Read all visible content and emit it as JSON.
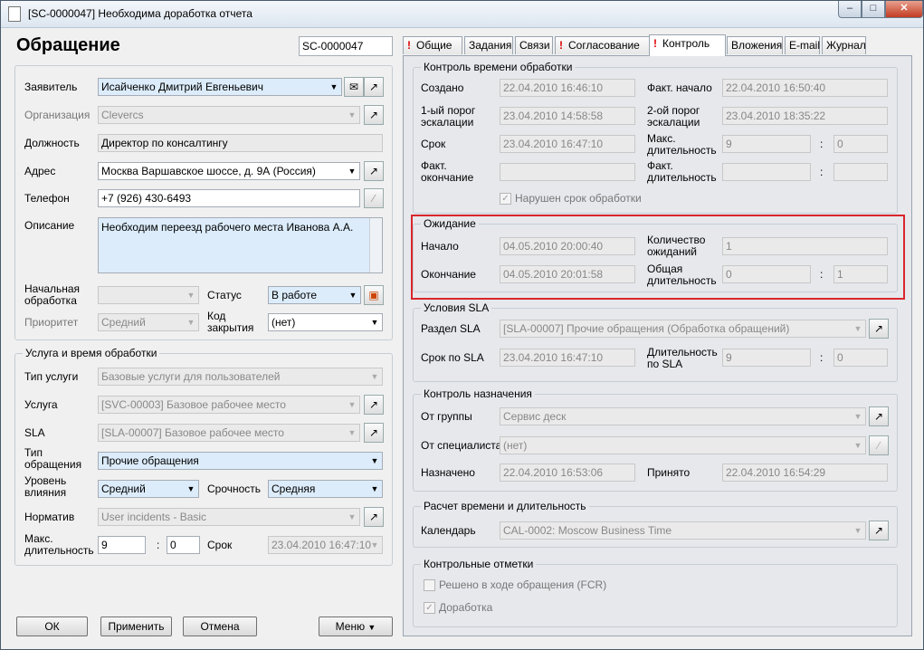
{
  "window": {
    "title": "[SC-0000047] Необходима доработка отчета"
  },
  "header": {
    "title": "Обращение",
    "number": "SC-0000047"
  },
  "left": {
    "applicant": {
      "label": "Заявитель",
      "value": "Исайченко Дмитрий Евгеньевич"
    },
    "organization": {
      "label": "Организация",
      "value": "Clevercs"
    },
    "position": {
      "label": "Должность",
      "value": "Директор по консалтингу"
    },
    "address": {
      "label": "Адрес",
      "value": "Москва Варшавское шоссе, д. 9А (Россия)"
    },
    "phone": {
      "label": "Телефон",
      "value": "+7 (926) 430-6493"
    },
    "description": {
      "label": "Описание",
      "value": "Необходим переезд рабочего места Иванова А.А."
    },
    "initial": {
      "label1": "Начальная",
      "label2": "обработка",
      "value": ""
    },
    "status": {
      "label": "Статус",
      "value": "В работе"
    },
    "priority": {
      "label": "Приоритет",
      "value": "Средний"
    },
    "close_code": {
      "label1": "Код",
      "label2": "закрытия",
      "value": "(нет)"
    }
  },
  "service": {
    "title": "Услуга и время обработки",
    "service_type": {
      "label": "Тип услуги",
      "value": "Базовые услуги для пользователей"
    },
    "service": {
      "label": "Услуга",
      "value": "[SVC-00003] Базовое рабочее место"
    },
    "sla": {
      "label": "SLA",
      "value": "[SLA-00007] Базовое рабочее место"
    },
    "request_type": {
      "label1": "Тип",
      "label2": "обращения",
      "value": "Прочие обращения"
    },
    "impact": {
      "label1": "Уровень",
      "label2": "влияния",
      "value": "Средний"
    },
    "urgency": {
      "label": "Срочность",
      "value": "Средняя"
    },
    "norm": {
      "label": "Норматив",
      "value": "User incidents - Basic"
    },
    "max_duration": {
      "label1": "Макс.",
      "label2": "длительность",
      "hours": "9",
      "minutes": "0"
    },
    "deadline": {
      "label": "Срок",
      "value": "23.04.2010 16:47:10"
    }
  },
  "buttons": {
    "ok": "ОК",
    "apply": "Применить",
    "cancel": "Отмена",
    "menu": "Меню"
  },
  "tabs": [
    {
      "label": "Общие",
      "alert": true
    },
    {
      "label": "Задания",
      "alert": false
    },
    {
      "label": "Связи",
      "alert": false
    },
    {
      "label": "Согласование",
      "alert": true
    },
    {
      "label": "Контроль",
      "alert": true
    },
    {
      "label": "Вложения",
      "alert": false
    },
    {
      "label": "E-mail",
      "alert": false
    },
    {
      "label": "Журнал",
      "alert": false
    }
  ],
  "alert_mark": "!",
  "processing": {
    "title": "Контроль времени обработки",
    "created": {
      "label": "Создано",
      "value": "22.04.2010 16:46:10"
    },
    "fact_start": {
      "label": "Факт. начало",
      "value": "22.04.2010 16:50:40"
    },
    "threshold1": {
      "label1": "1-ый порог",
      "label2": "эскалации",
      "value": "23.04.2010 14:58:58"
    },
    "threshold2": {
      "label1": "2-ой порог",
      "label2": "эскалации",
      "value": "23.04.2010 18:35:22"
    },
    "deadline": {
      "label": "Срок",
      "value": "23.04.2010 16:47:10"
    },
    "max_dur": {
      "label1": "Макс.",
      "label2": "длительность",
      "hours": "9",
      "minutes": "0"
    },
    "fact_end": {
      "label1": "Факт.",
      "label2": "окончание",
      "value": ""
    },
    "fact_dur": {
      "label1": "Факт.",
      "label2": "длительность",
      "hours": "",
      "minutes": ""
    },
    "violated": {
      "label": "Нарушен срок обработки",
      "checked": true
    }
  },
  "waiting": {
    "title": "Ожидание",
    "start": {
      "label": "Начало",
      "value": "04.05.2010 20:00:40"
    },
    "count": {
      "label1": "Количество",
      "label2": "ожиданий",
      "value": "1"
    },
    "end": {
      "label": "Окончание",
      "value": "04.05.2010 20:01:58"
    },
    "total": {
      "label1": "Общая",
      "label2": "длительность",
      "hours": "0",
      "minutes": "1"
    }
  },
  "sla_cond": {
    "title": "Условия SLA",
    "section": {
      "label": "Раздел SLA",
      "value": "[SLA-00007] Прочие обращения (Обработка обращений)"
    },
    "deadline": {
      "label": "Срок по SLA",
      "value": "23.04.2010 16:47:10"
    },
    "duration": {
      "label1": "Длительность",
      "label2": "по SLA",
      "hours": "9",
      "minutes": "0"
    }
  },
  "assign": {
    "title": "Контроль назначения",
    "group": {
      "label": "От группы",
      "value": "Сервис деск"
    },
    "specialist": {
      "label": "От специалиста",
      "value": "(нет)"
    },
    "assigned": {
      "label": "Назначено",
      "value": "22.04.2010 16:53:06"
    },
    "accepted": {
      "label": "Принято",
      "value": "22.04.2010 16:54:29"
    }
  },
  "calc": {
    "title": "Расчет времени и длительность",
    "calendar": {
      "label": "Календарь",
      "value": "CAL-0002: Moscow Business Time"
    }
  },
  "marks": {
    "title": "Контрольные отметки",
    "fcr": {
      "label": "Решено в ходе обращения (FCR)",
      "checked": false
    },
    "rework": {
      "label": "Доработка",
      "checked": true
    }
  },
  "sep": ":",
  "highlight_color": "#d9262c"
}
